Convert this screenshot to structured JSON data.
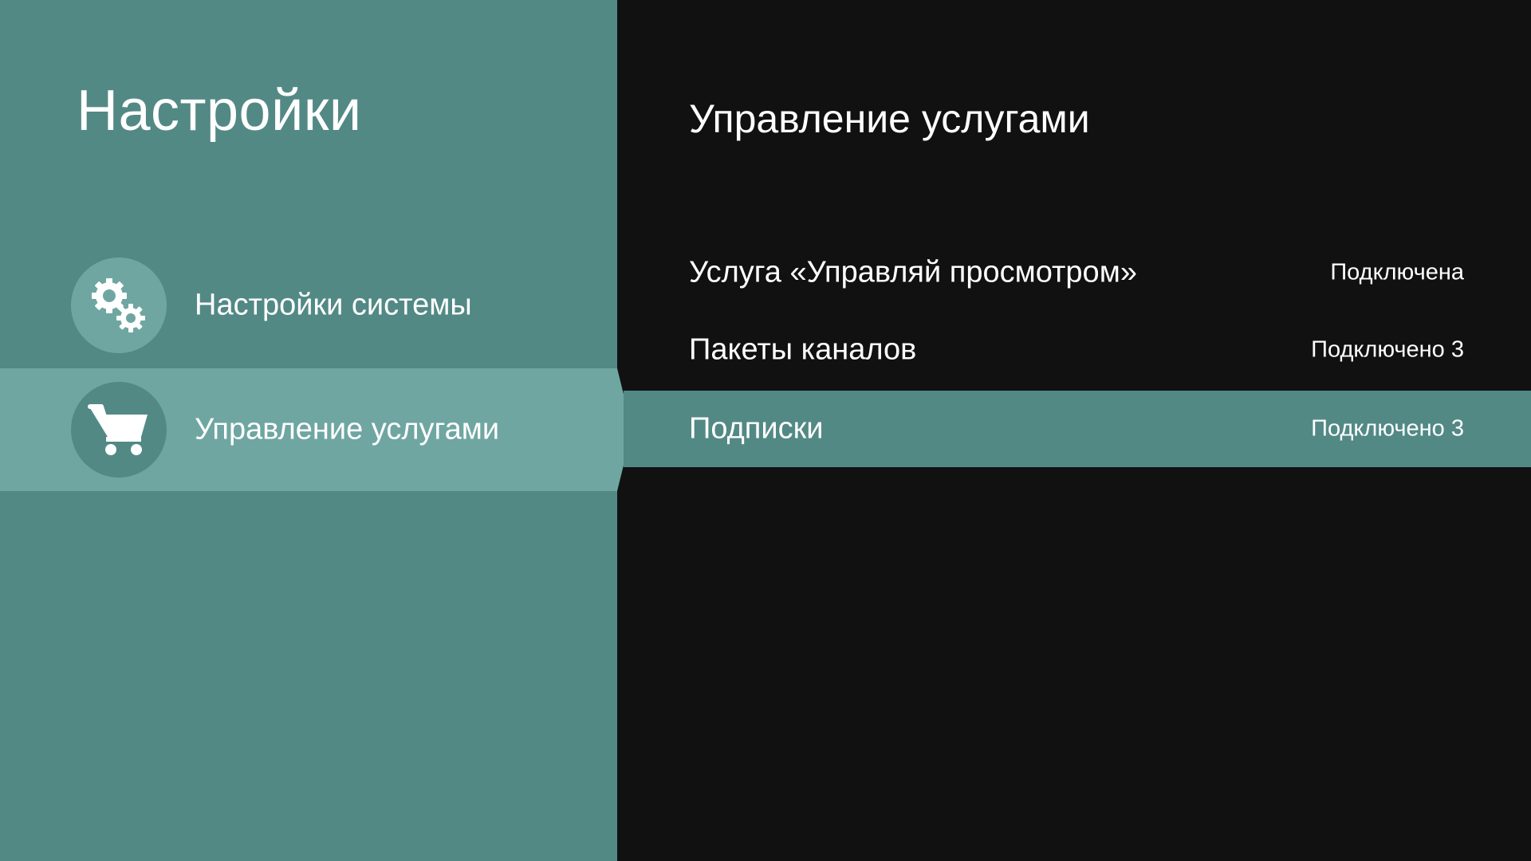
{
  "left": {
    "title": "Настройки",
    "menu": [
      {
        "label": "Настройки системы",
        "icon": "gears-icon",
        "active": false
      },
      {
        "label": "Управление услугами",
        "icon": "cart-icon",
        "active": true
      }
    ]
  },
  "right": {
    "title": "Управление услугами",
    "services": [
      {
        "name": "Услуга «Управляй просмотром»",
        "status": "Подключена",
        "selected": false
      },
      {
        "name": "Пакеты каналов",
        "status": "Подключено 3",
        "selected": false
      },
      {
        "name": "Подписки",
        "status": "Подключено 3",
        "selected": true
      }
    ]
  },
  "colors": {
    "panel": "#528985",
    "highlight": "#6fa6a2",
    "background": "#111111",
    "text": "#ffffff"
  }
}
